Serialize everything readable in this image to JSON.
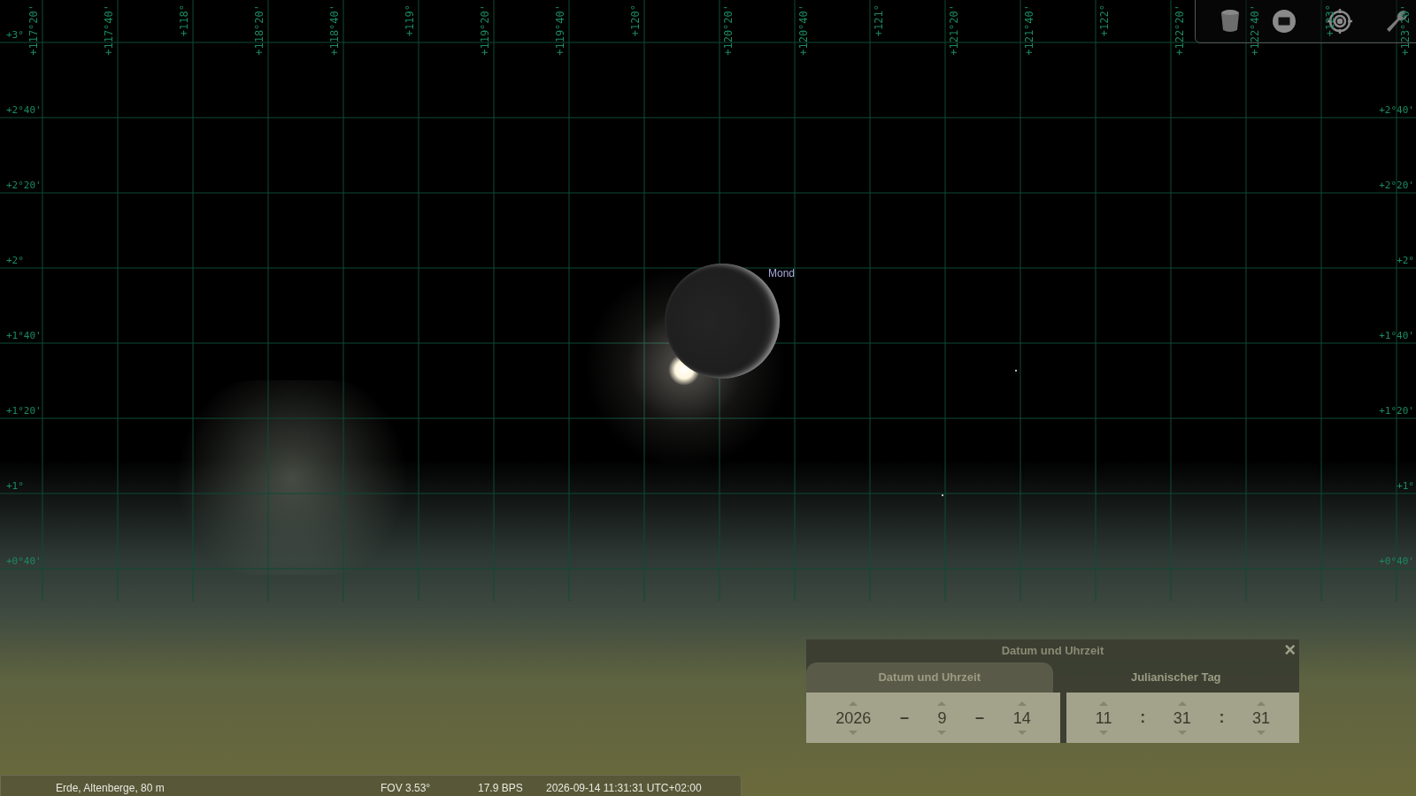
{
  "grid": {
    "top_labels": [
      "+117°20'",
      "+117°40'",
      "+118°",
      "+118°20'",
      "+118°40'",
      "+119°",
      "+119°20'",
      "+119°40'",
      "+120°",
      "+120°20'",
      "+120°40'",
      "+121°",
      "+121°20'",
      "+121°40'",
      "+122°",
      "+122°20'",
      "+122°40'",
      "+123°",
      "+123°20'"
    ],
    "left_labels": [
      "+3°",
      "+2°40'",
      "+2°20'",
      "+2°",
      "+1°40'",
      "+1°20'",
      "+1°",
      "+0°40'"
    ],
    "right_labels": [
      "+2°40'",
      "+2°20'",
      "+2°",
      "+1°40'",
      "+1°20'",
      "+1°",
      "+0°40'"
    ]
  },
  "moon": {
    "label": "Mond"
  },
  "toolbar": {
    "buttons": [
      {
        "kind": "cylinder"
      },
      {
        "kind": "screen"
      },
      {
        "kind": "target"
      },
      {
        "kind": "wrench"
      }
    ]
  },
  "dialog": {
    "title": "Datum und Uhrzeit",
    "close": "×",
    "tabs": [
      {
        "label": "Datum und Uhrzeit",
        "selected": true
      },
      {
        "label": "Julianischer Tag",
        "selected": false
      }
    ],
    "date_fields": [
      {
        "value": "2026"
      },
      {
        "value": "9"
      },
      {
        "value": "14"
      }
    ],
    "date_separators": [
      "–",
      "–"
    ],
    "time_fields": [
      {
        "value": "11"
      },
      {
        "value": "31"
      },
      {
        "value": "31"
      }
    ],
    "time_separators": [
      ":",
      ":"
    ]
  },
  "status_bar": {
    "location": "Erde, Altenberge, 80 m",
    "fov": "FOV 3.53°",
    "fps": "17.9 BPS",
    "datetime": "2026-09-14 11:31:31 UTC+02:00"
  }
}
